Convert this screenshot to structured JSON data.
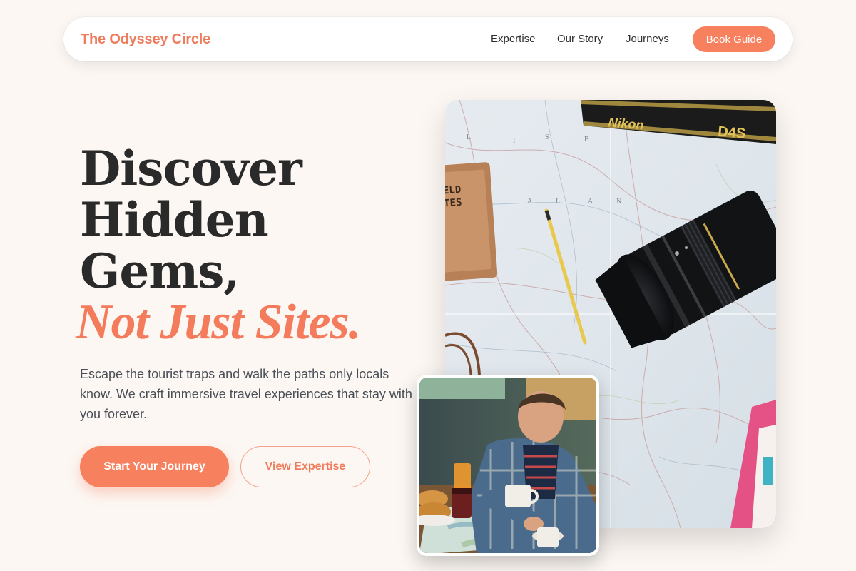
{
  "nav": {
    "brand": "The Odyssey Circle",
    "links": [
      "Expertise",
      "Our Story",
      "Journeys"
    ],
    "cta": "Book Guide"
  },
  "hero": {
    "headline_lines": [
      "Discover",
      "Hidden",
      "Gems,"
    ],
    "headline_accent": "Not Just Sites.",
    "subtext": "Escape the tourist traps and walk the paths only locals know. We craft immersive travel experiences that stay with you forever.",
    "primary_button": "Start Your Journey",
    "secondary_button": "View Expertise"
  },
  "images": {
    "main": {
      "camera_strap_text": "Nikon",
      "camera_model": "D4S"
    },
    "inset": {}
  },
  "colors": {
    "accent": "#f7805f",
    "background": "#fcf7f3",
    "text_dark": "#2a2a2a"
  }
}
